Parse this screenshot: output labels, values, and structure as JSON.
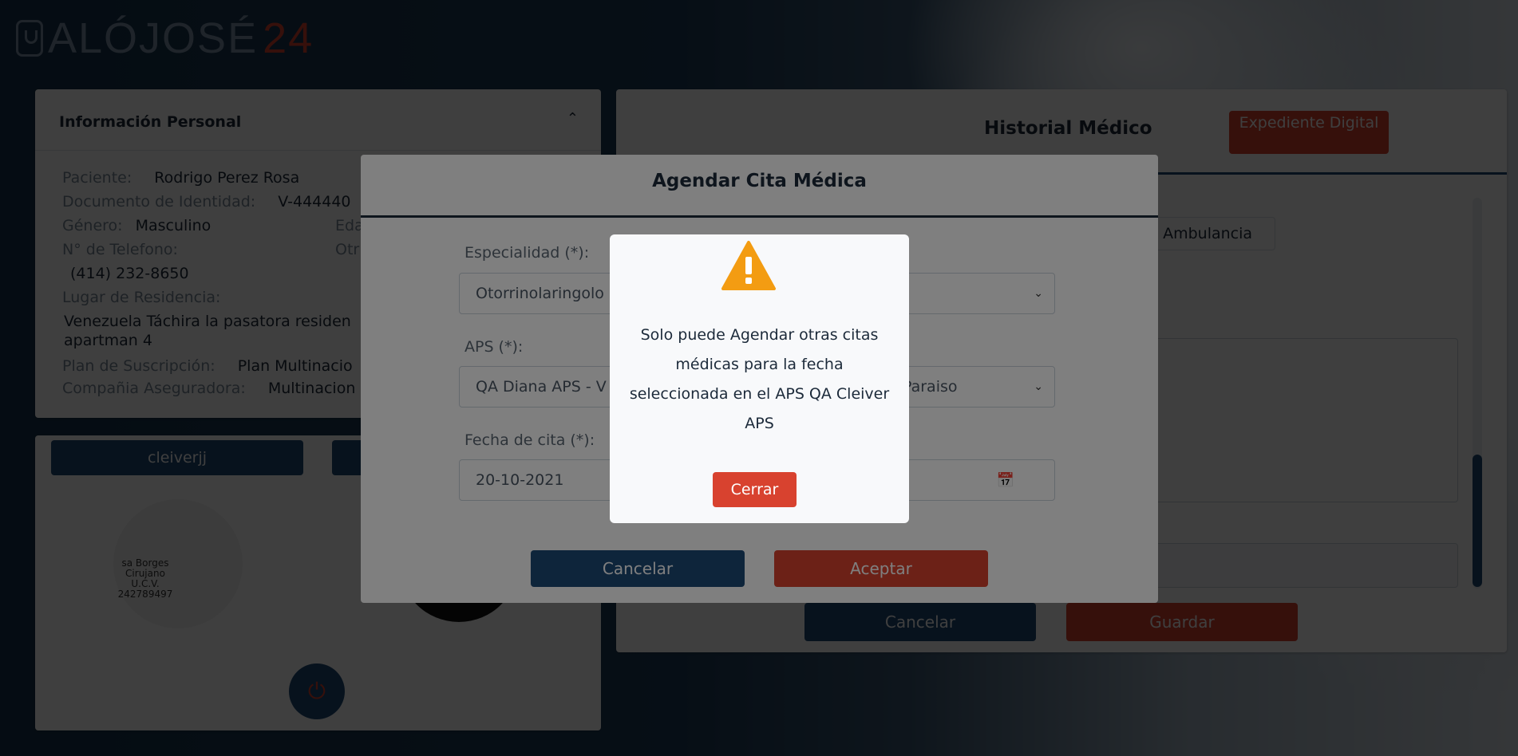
{
  "brand": {
    "logo_main": "ALÓJOSÉ",
    "logo_accent": "24"
  },
  "personal_info": {
    "title": "Información Personal",
    "patient_label": "Paciente:",
    "patient_value": "Rodrigo Perez Rosa",
    "id_label": "Documento de Identidad:",
    "id_value": "V-444440",
    "gender_label": "Género:",
    "gender_value": "Masculino",
    "age_label_partial": "Eda",
    "phone_label": "N° de Telefono:",
    "other_label_partial": "Otr",
    "phone_value": "(414) 232-8650",
    "residence_label": "Lugar de Residencia:",
    "residence_line1": "Venezuela Táchira la pasatora residen",
    "residence_line2": "apartman 4",
    "plan_label": "Plan de Suscripción:",
    "plan_value": "Plan Multinacio",
    "insurer_label": "Compañia Aseguradora:",
    "insurer_value": "Multinacion"
  },
  "user_panel": {
    "username_button": "cleiverjj",
    "signature_text": "sa Borges\nCirujano U.C.V.\n242789497"
  },
  "medical_history": {
    "title": "Historial Médico",
    "expediente_button": "Expediente Digital",
    "ambulance_tab": ". Ambulancia",
    "cancel_button": "Cancelar",
    "save_button": "Guardar"
  },
  "appointment_modal": {
    "title": "Agendar Cita Médica",
    "specialty_label": "Especialidad (*):",
    "specialty_value": "Otorrinolaringolo",
    "aps_label": "APS (*):",
    "aps_value": "QA Diana APS - V",
    "location_value_partial": "Paraiso",
    "date_label": "Fecha de cita (*):",
    "date_value": "20-10-2021",
    "cancel_button": "Cancelar",
    "accept_button": "Aceptar"
  },
  "alert": {
    "message": "Solo puede Agendar otras citas médicas para la fecha seleccionada en el APS QA Cleiver APS",
    "close_button": "Cerrar"
  },
  "colors": {
    "primary": "#1d4a77",
    "accent": "#d8422f",
    "warning": "#f39c12"
  }
}
